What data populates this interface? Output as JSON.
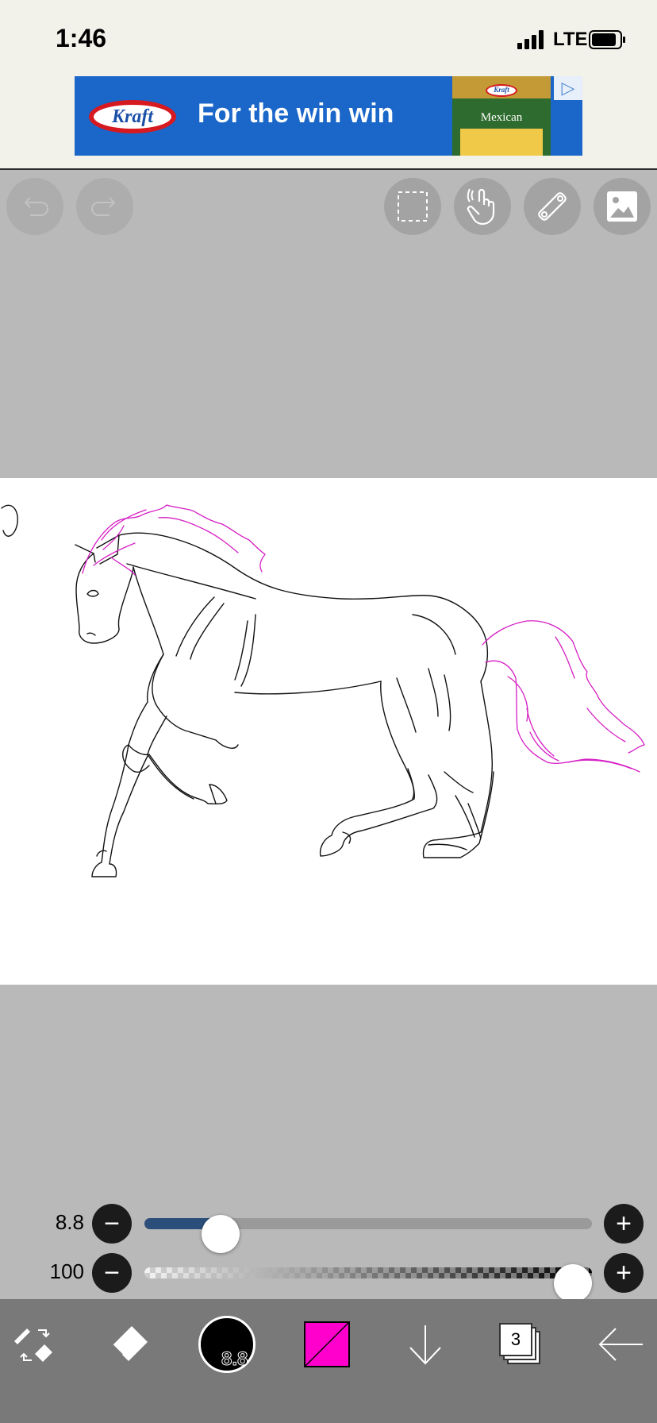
{
  "status_bar": {
    "time": "1:46",
    "network": "LTE"
  },
  "ad": {
    "brand": "Kraft",
    "headline": "For the win win",
    "product_brand": "Kraft",
    "product_name": "Mexican",
    "choices_icon": "ad-choices-icon"
  },
  "top_toolbar": {
    "buttons": [
      {
        "name": "undo-button",
        "icon": "undo-icon",
        "enabled": false
      },
      {
        "name": "redo-button",
        "icon": "redo-icon",
        "enabled": false
      },
      {
        "name": "selection-button",
        "icon": "selection-icon",
        "enabled": true
      },
      {
        "name": "hand-button",
        "icon": "hand-icon",
        "enabled": true
      },
      {
        "name": "ruler-button",
        "icon": "ruler-icon",
        "enabled": true
      },
      {
        "name": "image-button",
        "icon": "image-icon",
        "enabled": true
      }
    ]
  },
  "canvas": {
    "background": "#ffffff",
    "line_color": "#111111",
    "accent_line_color": "#d61fc4"
  },
  "brush_size": {
    "value": "8.8",
    "level_fraction": 0.14
  },
  "opacity": {
    "value": "100",
    "level_fraction": 1.0
  },
  "bottom_toolbar": {
    "tools": [
      "pen-eraser-switch-icon",
      "eraser-icon",
      "brush-size-icon",
      "color-icon",
      "save-arrow-icon",
      "layers-icon",
      "back-icon"
    ],
    "brush_size_label": "8.8",
    "current_color": "#ff00cc",
    "layer_count": "3"
  }
}
